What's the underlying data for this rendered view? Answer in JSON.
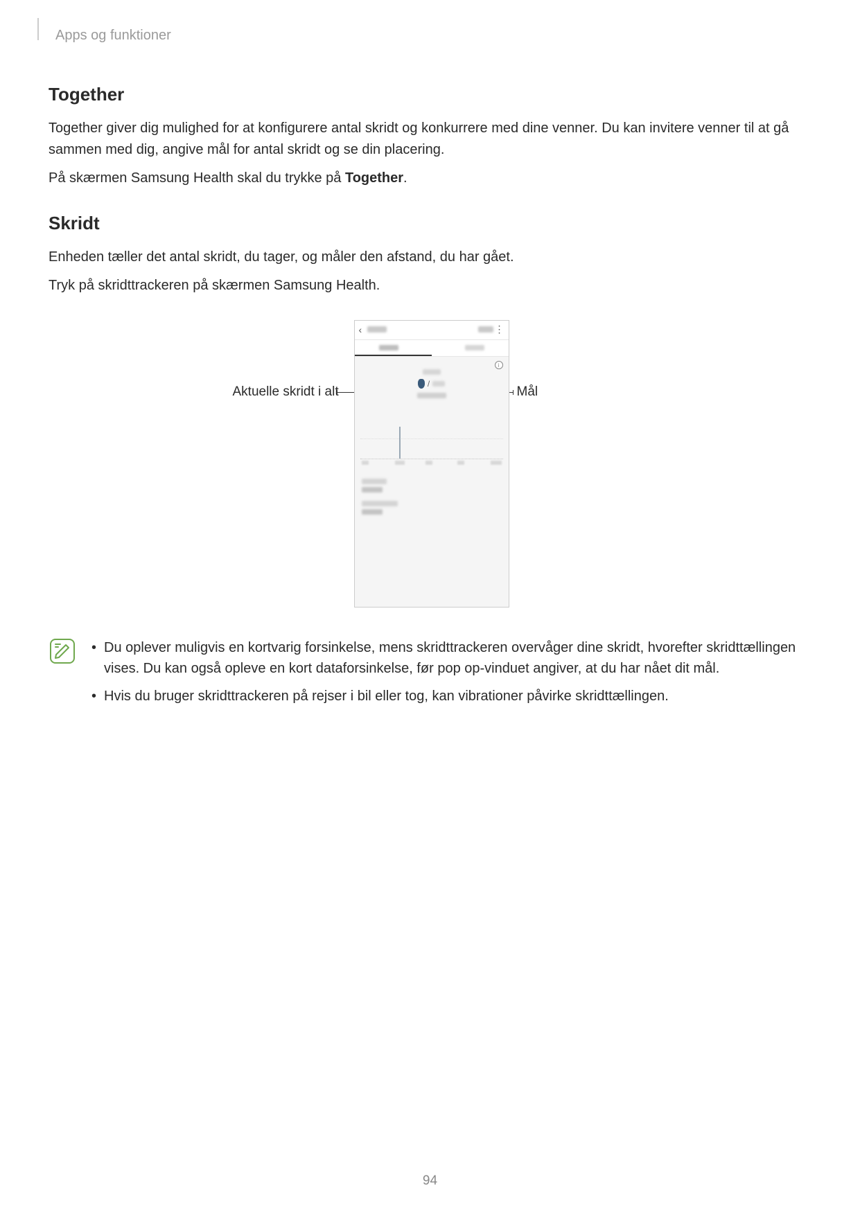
{
  "breadcrumb": "Apps og funktioner",
  "sections": {
    "together": {
      "heading": "Together",
      "p1": "Together giver dig mulighed for at konfigurere antal skridt og konkurrere med dine venner. Du kan invitere venner til at gå sammen med dig, angive mål for antal skridt og se din placering.",
      "p2_a": "På skærmen Samsung Health skal du trykke på ",
      "p2_b": "Together",
      "p2_c": "."
    },
    "skridt": {
      "heading": "Skridt",
      "p1": "Enheden tæller det antal skridt, du tager, og måler den afstand, du har gået.",
      "p2": "Tryk på skridttrackeren på skærmen Samsung Health."
    }
  },
  "callouts": {
    "left": "Aktuelle skridt i alt",
    "right": "Mål"
  },
  "phone_ui": {
    "slash": "/",
    "info": "i"
  },
  "notes": {
    "item1": "Du oplever muligvis en kortvarig forsinkelse, mens skridttrackeren overvåger dine skridt, hvorefter skridttællingen vises. Du kan også opleve en kort dataforsinkelse, før pop op-vinduet angiver, at du har nået dit mål.",
    "item2": "Hvis du bruger skridttrackeren på rejser i bil eller tog, kan vibrationer påvirke skridttællingen."
  },
  "page_number": "94"
}
